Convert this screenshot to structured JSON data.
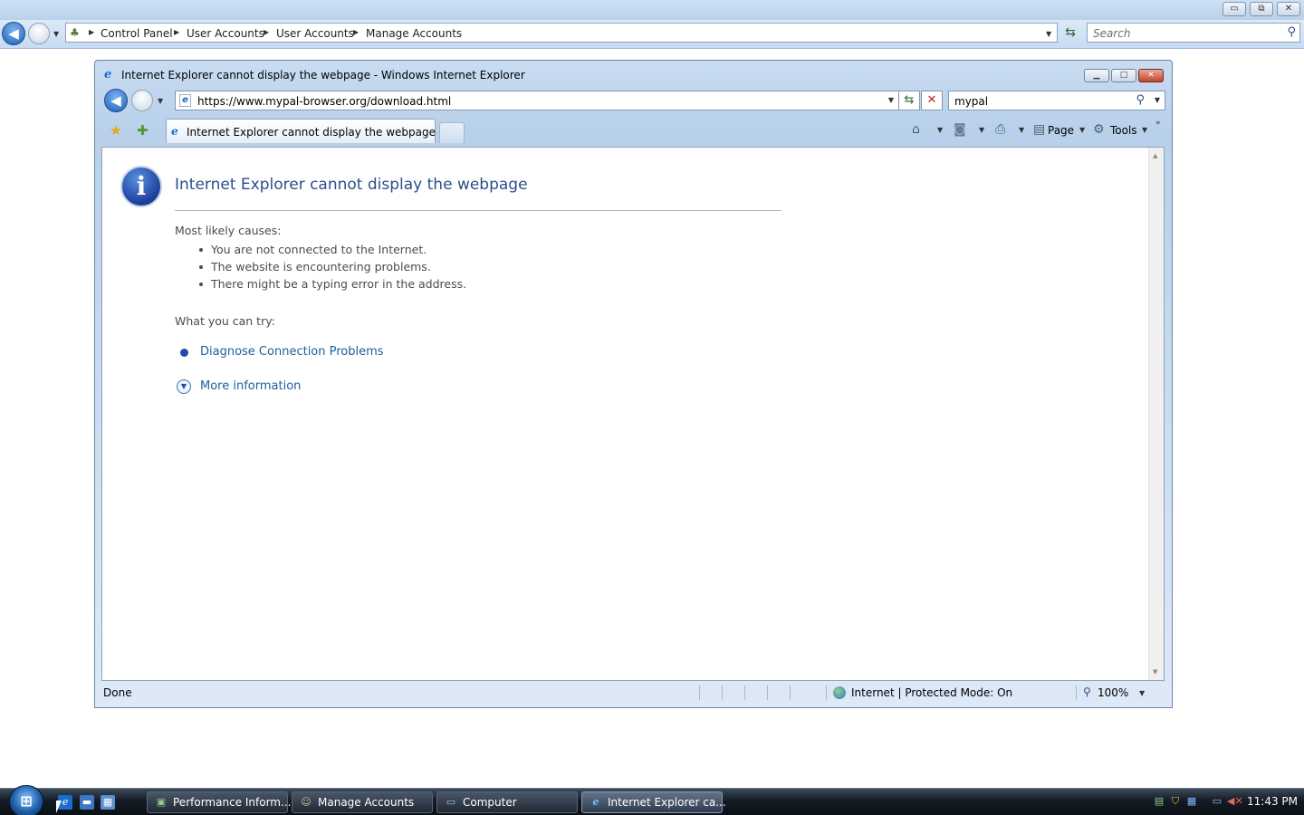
{
  "explorer": {
    "breadcrumbs": [
      "Control Panel",
      "User Accounts",
      "User Accounts",
      "Manage Accounts"
    ],
    "search_placeholder": "Search",
    "caption": {
      "minimize": "▭",
      "restore": "⧉",
      "close": "✕"
    }
  },
  "ie": {
    "title": "Internet Explorer cannot display the webpage - Windows Internet Explorer",
    "url": "https://www.mypal-browser.org/download.html",
    "search_value": "mypal",
    "tab_label": "Internet Explorer cannot display the webpage",
    "commands": {
      "page": "Page",
      "tools": "Tools"
    },
    "error": {
      "title": "Internet Explorer cannot display the webpage",
      "causes_heading": "Most likely causes:",
      "causes": [
        "You are not connected to the Internet.",
        "The website is encountering problems.",
        "There might be a typing error in the address."
      ],
      "try_heading": "What you can try:",
      "diagnose_link": "Diagnose Connection Problems",
      "more_info_link": "More information"
    },
    "status": {
      "done": "Done",
      "zone": "Internet | Protected Mode: On",
      "zoom": "100%"
    }
  },
  "taskbar": {
    "tasks": [
      {
        "label": "Performance Inform...",
        "icon": "performance-icon"
      },
      {
        "label": "Manage Accounts",
        "icon": "users-icon"
      },
      {
        "label": "Computer",
        "icon": "computer-icon"
      },
      {
        "label": "Internet Explorer ca...",
        "icon": "ie-icon",
        "active": true
      }
    ],
    "clock": "11:43 PM"
  }
}
